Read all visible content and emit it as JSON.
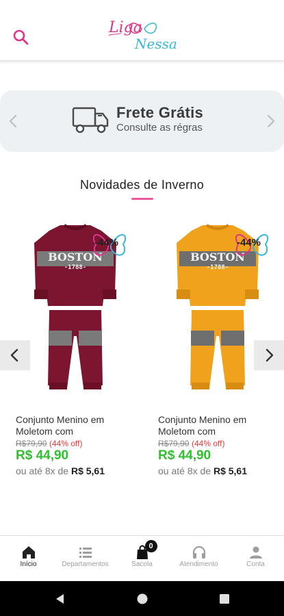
{
  "header": {
    "logo_line1": "Liga",
    "logo_line2": "Nessa"
  },
  "banner": {
    "title": "Frete Grátis",
    "subtitle": "Consulte as régras"
  },
  "section": {
    "title": "Novidades de Inverno"
  },
  "products": [
    {
      "name": "Conjunto Menino em Moletom com",
      "old_price": "R$79,90",
      "discount": "(44% off)",
      "price": "R$ 44,90",
      "installment_prefix": "ou até 8x de",
      "installment_value": "R$ 5,61",
      "badge": "-44%",
      "shirt_text": "BOSTON",
      "shirt_year": "-1788-",
      "color": "#7b1530"
    },
    {
      "name": "Conjunto Menino em Moletom com",
      "old_price": "R$79,90",
      "discount": "(44% off)",
      "price": "R$ 44,90",
      "installment_prefix": "ou até 8x de",
      "installment_value": "R$ 5,61",
      "badge": "-44%",
      "shirt_text": "BOSTON",
      "shirt_year": "-1788-",
      "color": "#f0a21c"
    }
  ],
  "nav": {
    "items": [
      {
        "label": "Início",
        "icon": "home-icon"
      },
      {
        "label": "Departamentos",
        "icon": "list-icon"
      },
      {
        "label": "Sacola",
        "icon": "bag-icon",
        "badge": "0"
      },
      {
        "label": "Atendimento",
        "icon": "headset-icon"
      },
      {
        "label": "Conta",
        "icon": "person-icon"
      }
    ]
  },
  "colors": {
    "brand_pink": "#e0338a",
    "brand_blue": "#37b7d6",
    "price_green": "#2fbf2f",
    "discount_red": "#e53935"
  }
}
